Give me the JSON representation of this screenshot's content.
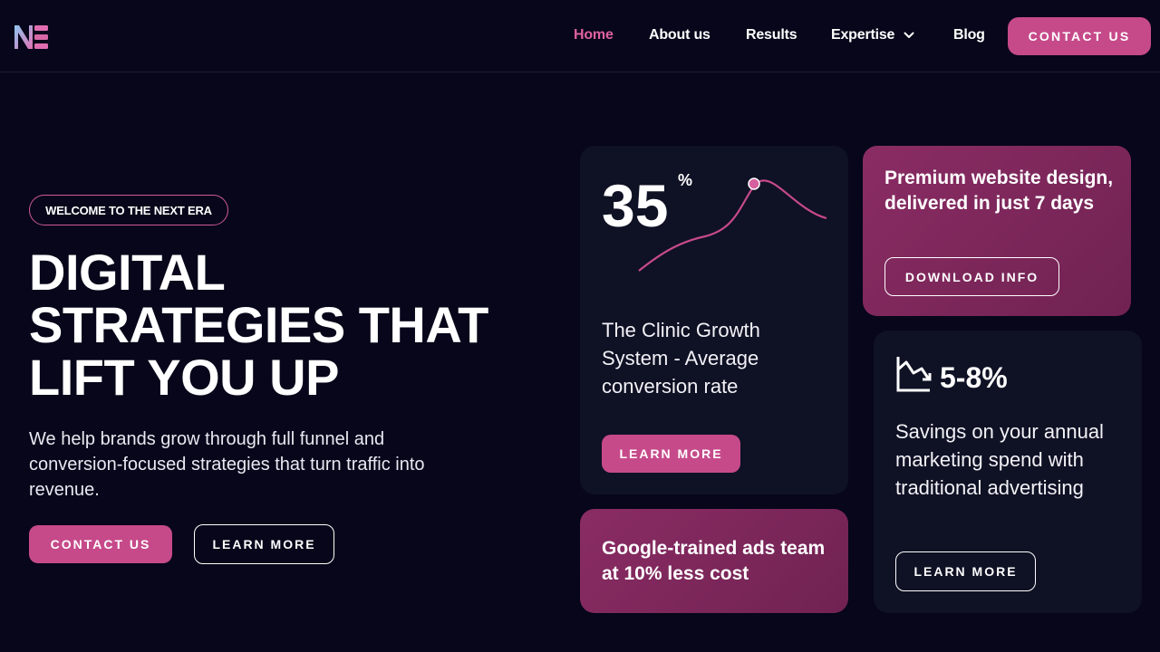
{
  "header": {
    "logo_text": "NE",
    "nav": [
      "Home",
      "About us",
      "Results",
      "Expertise",
      "Blog"
    ],
    "contact_button": "CONTACT US"
  },
  "hero": {
    "badge": "WELCOME TO THE NEXT ERA",
    "title_lines": [
      "DIGITAL",
      "STRATEGIES THAT",
      "LIFT YOU UP"
    ],
    "description": "We help brands grow through full funnel and conversion-focused strategies that turn traffic into revenue.",
    "primary_button": "CONTACT US",
    "secondary_button": "LEARN MORE"
  },
  "cards": {
    "conversion": {
      "value": "35",
      "unit": "%",
      "text": "The Clinic Growth System - Average conversion rate",
      "button": "LEARN MORE"
    },
    "website": {
      "text": "Premium website design, delivered in just 7 days",
      "button": "DOWNLOAD INFO"
    },
    "ads": {
      "text": "Google-trained ads team at 10% less cost"
    },
    "savings": {
      "icon": "chart-down-icon",
      "value": "5-8%",
      "text": "Savings on your annual marketing spend with traditional advertising",
      "button": "LEARN MORE"
    }
  },
  "colors": {
    "background": "#07061a",
    "accent_pink": "#c64a8a",
    "active_nav": "#e0629f",
    "card_dark": "#0f1124",
    "card_pink": "#7d2759"
  }
}
